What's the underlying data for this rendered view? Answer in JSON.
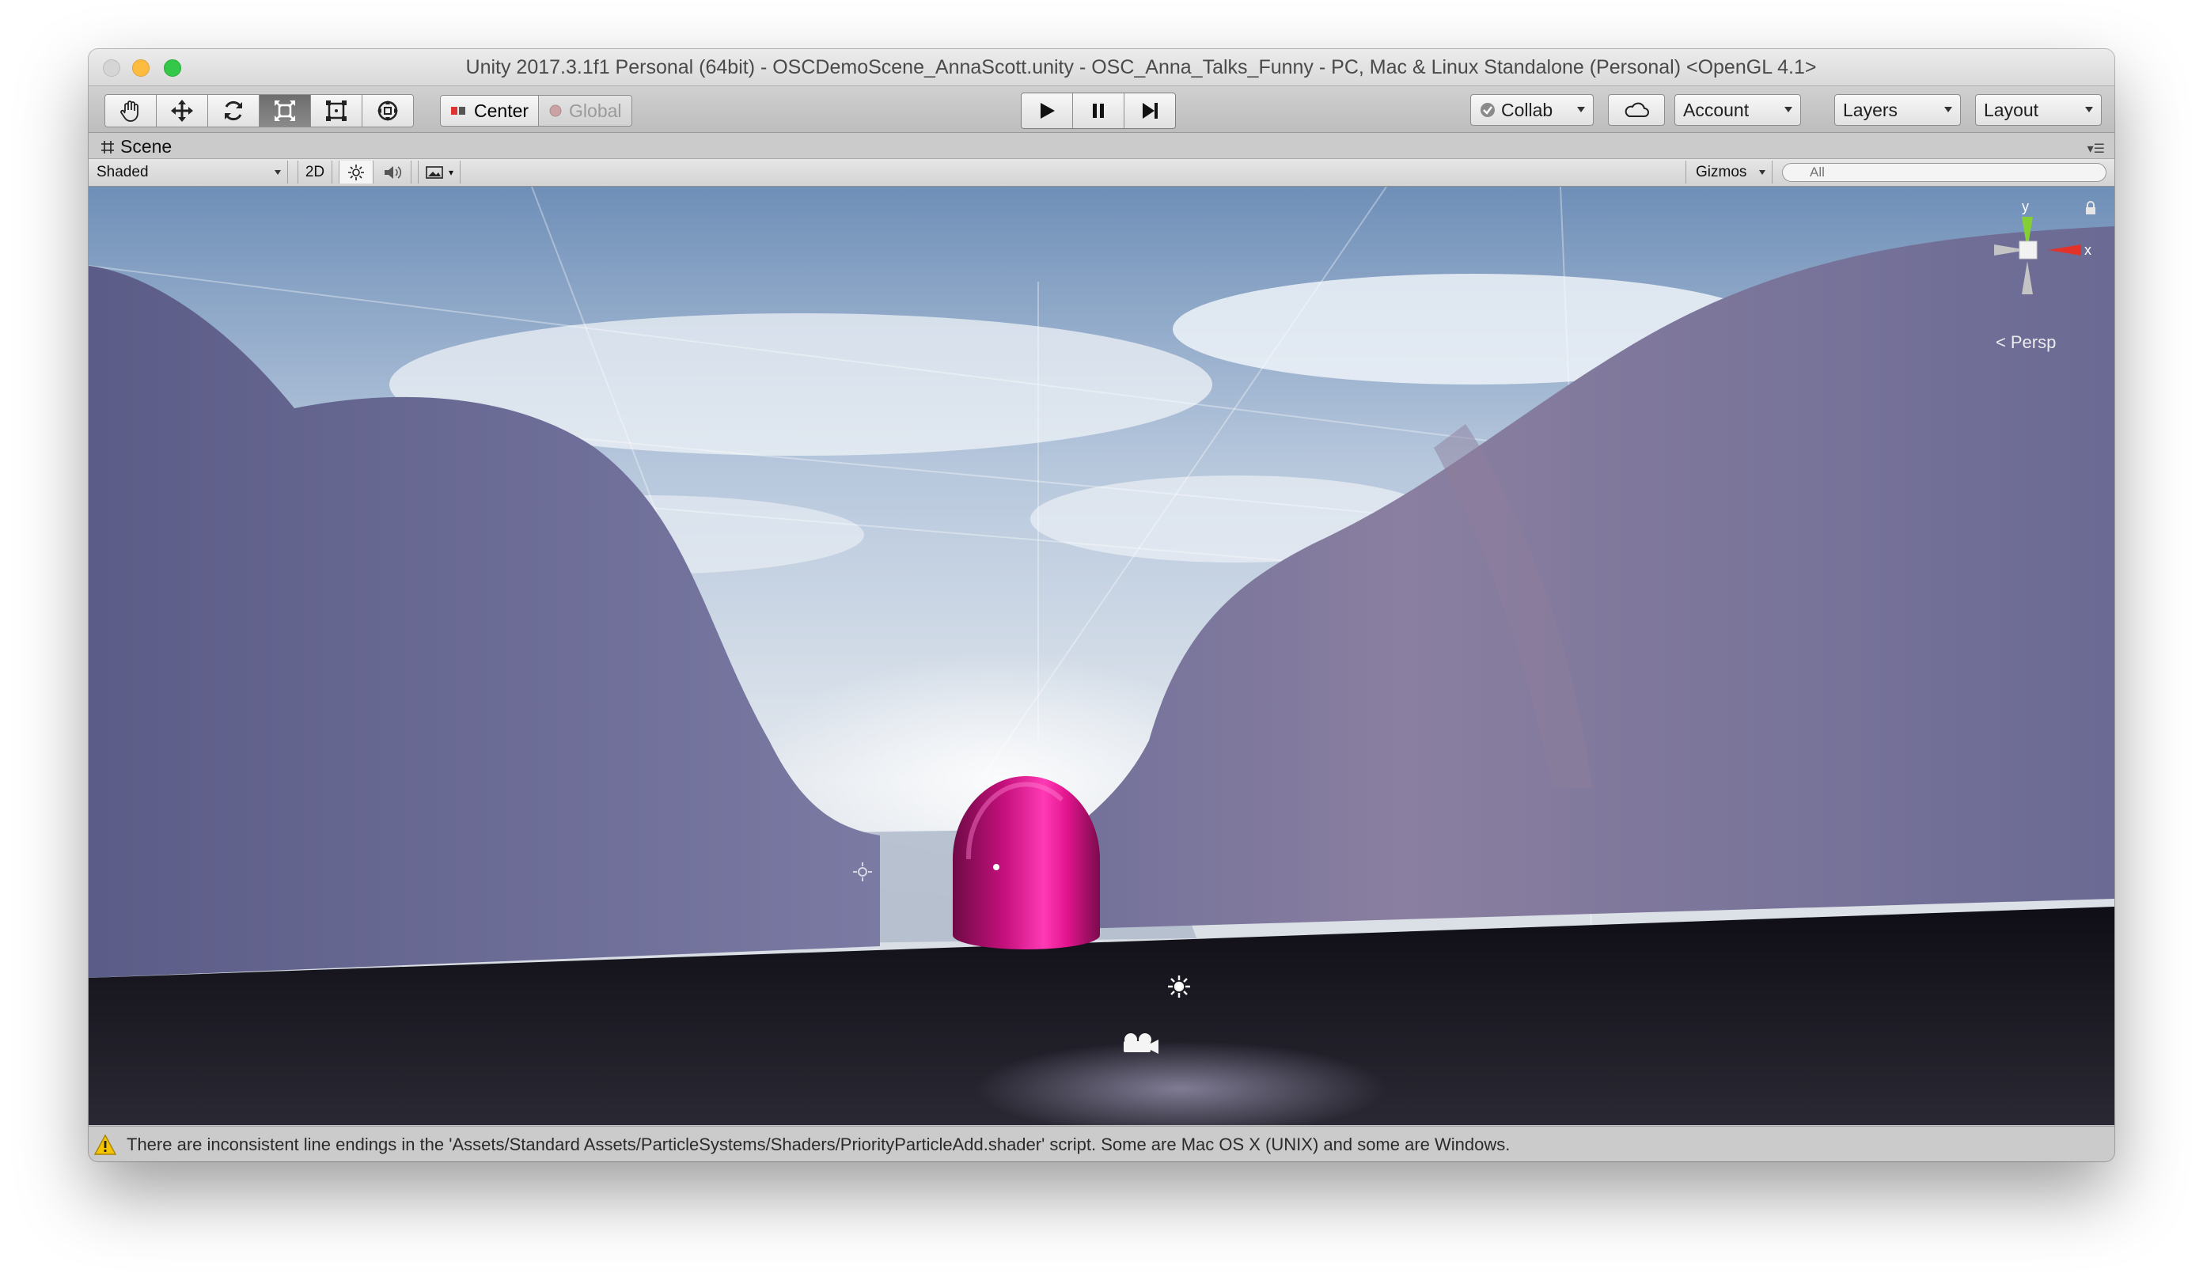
{
  "window": {
    "title": "Unity 2017.3.1f1 Personal (64bit) - OSCDemoScene_AnnaScott.unity - OSC_Anna_Talks_Funny - PC, Mac & Linux Standalone (Personal) <OpenGL 4.1>"
  },
  "toolbar": {
    "tools": [
      {
        "name": "hand-tool",
        "icon": "hand-icon",
        "active": false
      },
      {
        "name": "move-tool",
        "icon": "move-icon",
        "active": false
      },
      {
        "name": "rotate-tool",
        "icon": "rotate-icon",
        "active": false
      },
      {
        "name": "scale-tool",
        "icon": "scale-icon",
        "active": true
      },
      {
        "name": "rect-tool",
        "icon": "rect-icon",
        "active": false
      },
      {
        "name": "transform-tool",
        "icon": "transform-icon",
        "active": false
      }
    ],
    "pivot_label": "Center",
    "rotation_label": "Global",
    "collab_label": "Collab",
    "account_label": "Account",
    "layers_label": "Layers",
    "layout_label": "Layout"
  },
  "scene": {
    "tab_label": "Scene",
    "draw_mode": "Shaded",
    "mode_2d": "2D",
    "gizmos_label": "Gizmos",
    "search_placeholder": "All",
    "projection_label": "Persp",
    "gizmo_axes": {
      "y": "y",
      "x": "x"
    }
  },
  "status": {
    "message": "There are inconsistent line endings in the 'Assets/Standard Assets/ParticleSystems/Shaders/PriorityParticleAdd.shader' script. Some are Mac OS X (UNIX) and some are Windows.",
    "warning_color": "#f5c400"
  },
  "colors": {
    "capsule": "#e0148c",
    "cliff": "#6a6a94",
    "ground": "#1a1822"
  }
}
